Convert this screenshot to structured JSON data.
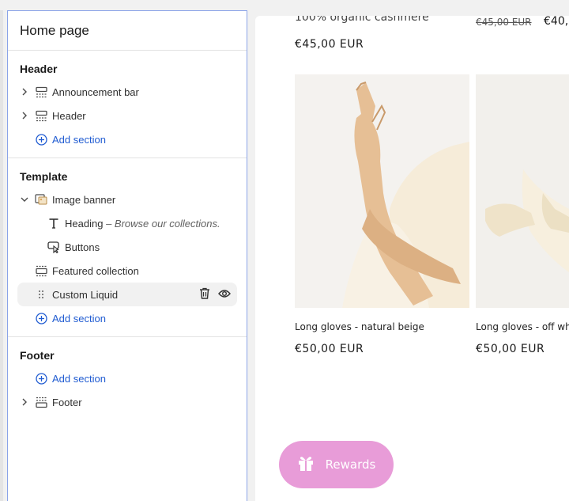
{
  "sidebar": {
    "title": "Home page",
    "header_group": {
      "title": "Header",
      "items": [
        {
          "label": "Announcement bar",
          "icon": "section-icon"
        },
        {
          "label": "Header",
          "icon": "section-icon"
        }
      ],
      "add_label": "Add section"
    },
    "template_group": {
      "title": "Template",
      "image_banner": {
        "label": "Image banner",
        "children": [
          {
            "label": "Heading",
            "detail": "– Browse our collections."
          },
          {
            "label": "Buttons"
          }
        ]
      },
      "featured": {
        "label": "Featured collection"
      },
      "custom_liquid": {
        "label": "Custom Liquid"
      },
      "add_label": "Add section"
    },
    "footer_group": {
      "title": "Footer",
      "add_label": "Add section",
      "items": [
        {
          "label": "Footer"
        }
      ]
    }
  },
  "preview": {
    "top_left_text": "100% organic cashmere",
    "top_left_price": "€45,00 EUR",
    "top_right_old_price": "€45,00 EUR",
    "top_right_price": "€40,",
    "products": [
      {
        "name": "Long gloves - natural beige",
        "price": "€50,00 EUR"
      },
      {
        "name": "Long gloves - off wh",
        "price": "€50,00 EUR"
      }
    ],
    "rewards_label": "Rewards"
  },
  "colors": {
    "accent": "#1f5bd1",
    "rewards": "#e89cd8"
  }
}
